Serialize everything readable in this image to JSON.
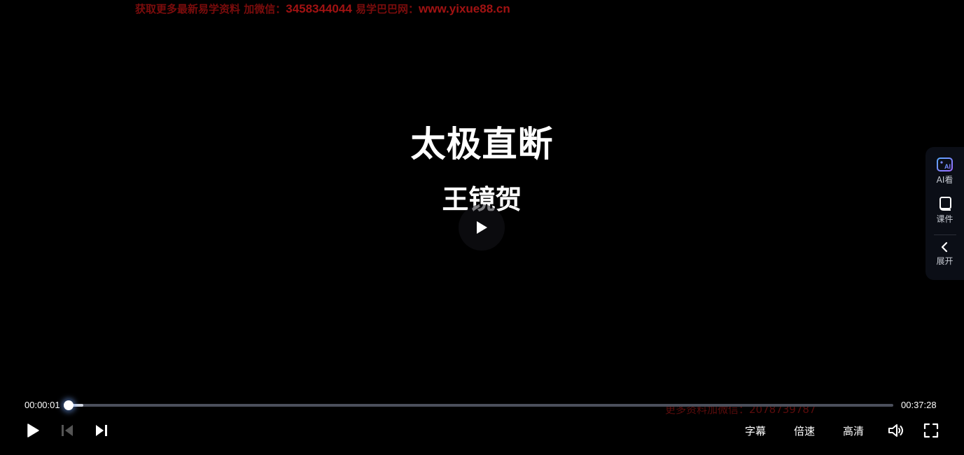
{
  "watermark": {
    "prefix": "获取更多最新易学资料 加微信：",
    "phone": "3458344044",
    "middle": " 易学巴巴网：",
    "url": "www.yixue88.cn",
    "bottom": "更多资料加微信：2078739787"
  },
  "video": {
    "title": "太极直断",
    "subtitle": "王镜贺"
  },
  "side_panel": {
    "ai_label": "AI看",
    "courseware_label": "课件",
    "expand_label": "展开"
  },
  "controls": {
    "current_time": "00:00:01",
    "total_time": "00:37:28",
    "progress_fraction": 0.0004,
    "buffered_fraction": 0.018,
    "subtitle_label": "字幕",
    "speed_label": "倍速",
    "quality_label": "高清"
  },
  "colors": {
    "background": "#000000",
    "accent_ai": "#7b8cff",
    "watermark": "#7a0c0c"
  },
  "icons": [
    "play-icon",
    "prev-icon",
    "next-icon",
    "volume-icon",
    "fullscreen-icon",
    "ai-icon",
    "courseware-icon",
    "chevron-left-icon"
  ]
}
